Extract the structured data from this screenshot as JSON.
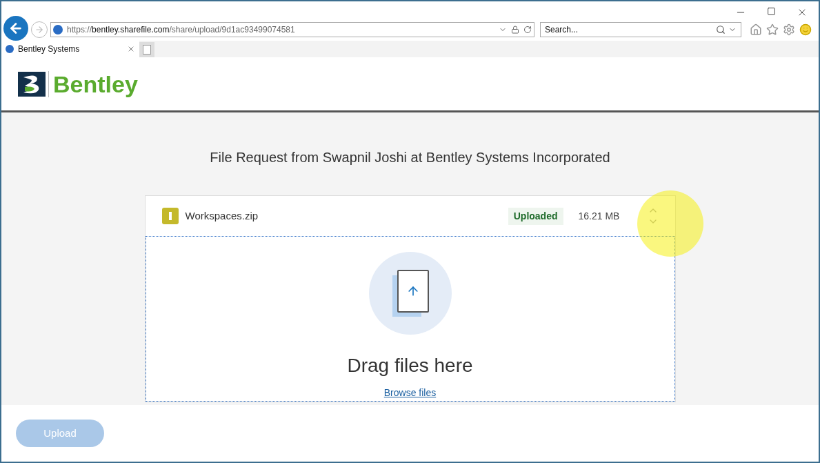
{
  "browser": {
    "url": {
      "scheme": "https://",
      "host": "bentley.sharefile.com",
      "path": "/share/upload/9d1ac93499074581"
    },
    "search": {
      "placeholder": "Search..."
    },
    "tabs": [
      {
        "title": "Bentley Systems",
        "selected": true
      }
    ]
  },
  "header": {
    "logo_text": "Bentley"
  },
  "page": {
    "title": "File Request from Swapnil Joshi at Bentley Systems Incorporated",
    "files": [
      {
        "name": "Workspaces.zip",
        "status": "Uploaded",
        "size": "16.21 MB"
      }
    ],
    "dropzone": {
      "text": "Drag files here",
      "link": "Browse files"
    },
    "upload_button": {
      "label": "Upload",
      "disabled": true
    }
  }
}
